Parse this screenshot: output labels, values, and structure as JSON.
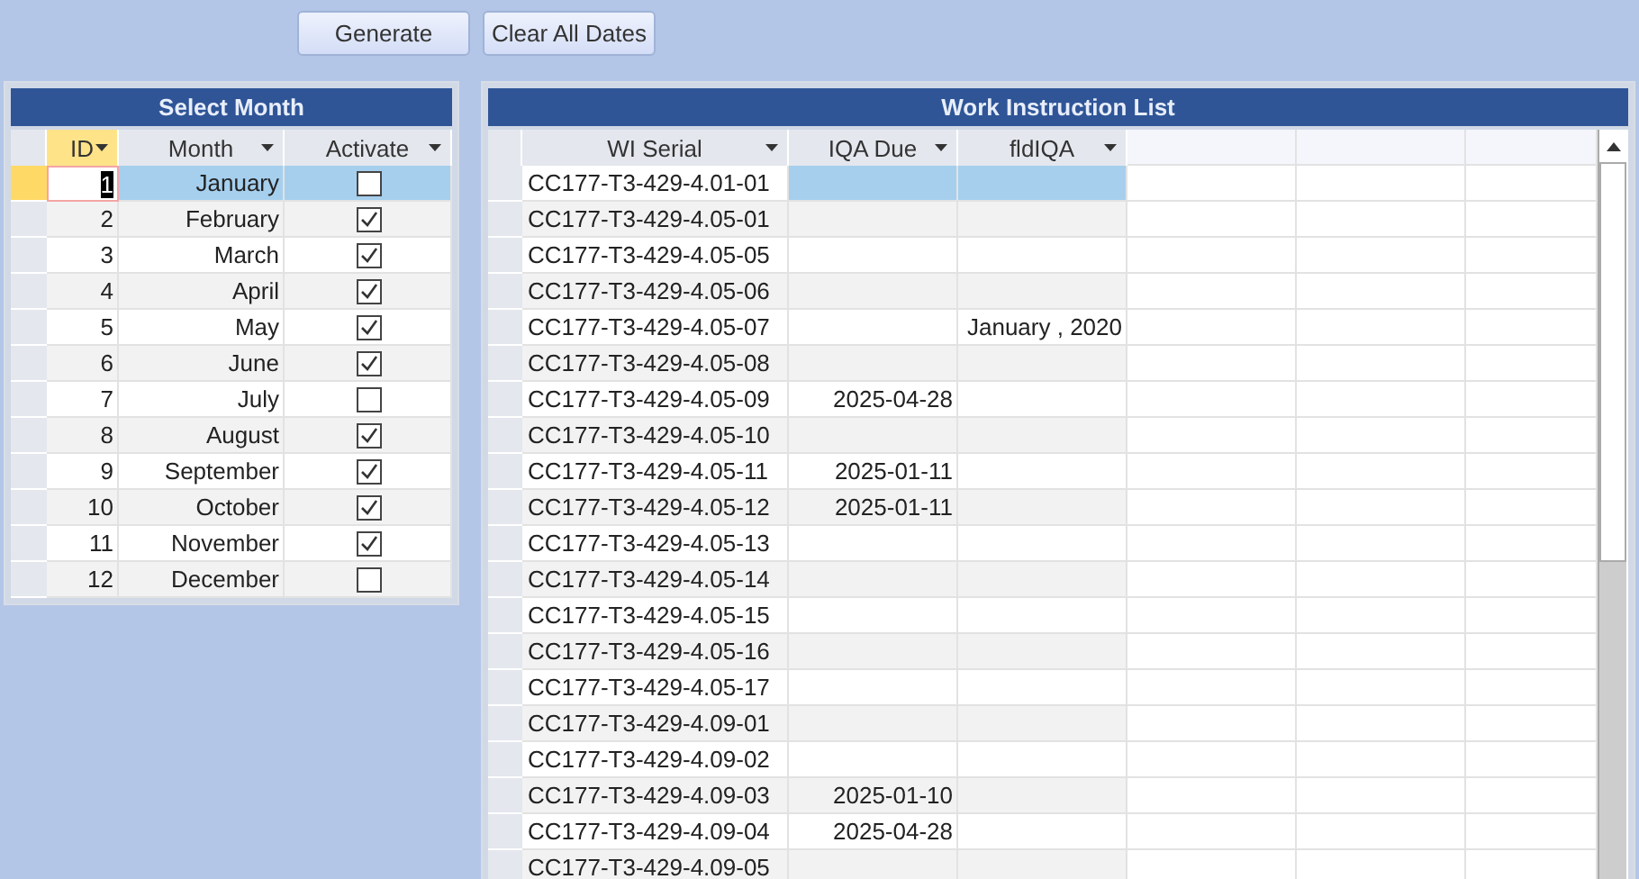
{
  "buttons": [
    "Generate",
    "Clear All Dates"
  ],
  "select_month": {
    "title": "Select Month",
    "columns": [
      {
        "label": "ID",
        "selected": true
      },
      {
        "label": "Month",
        "selected": false
      },
      {
        "label": "Activate",
        "selected": false
      }
    ],
    "rows": [
      {
        "id": "1",
        "month": "January",
        "activate": false,
        "selected": true
      },
      {
        "id": "2",
        "month": "February",
        "activate": true,
        "selected": false
      },
      {
        "id": "3",
        "month": "March",
        "activate": true,
        "selected": false
      },
      {
        "id": "4",
        "month": "April",
        "activate": true,
        "selected": false
      },
      {
        "id": "5",
        "month": "May",
        "activate": true,
        "selected": false
      },
      {
        "id": "6",
        "month": "June",
        "activate": true,
        "selected": false
      },
      {
        "id": "7",
        "month": "July",
        "activate": false,
        "selected": false
      },
      {
        "id": "8",
        "month": "August",
        "activate": true,
        "selected": false
      },
      {
        "id": "9",
        "month": "September",
        "activate": true,
        "selected": false
      },
      {
        "id": "10",
        "month": "October",
        "activate": true,
        "selected": false
      },
      {
        "id": "11",
        "month": "November",
        "activate": true,
        "selected": false
      },
      {
        "id": "12",
        "month": "December",
        "activate": false,
        "selected": false
      }
    ]
  },
  "work_instruction_list": {
    "title": "Work Instruction List",
    "columns": [
      {
        "label": "WI Serial",
        "selected": false
      },
      {
        "label": "IQA Due",
        "selected": false
      },
      {
        "label": "fldIQA",
        "selected": false
      }
    ],
    "rows": [
      {
        "wi_serial": "CC177-T3-429-4.01-01",
        "iqa_due": "",
        "fld_iqa": "",
        "selected": true
      },
      {
        "wi_serial": "CC177-T3-429-4.05-01",
        "iqa_due": "",
        "fld_iqa": "",
        "selected": false
      },
      {
        "wi_serial": "CC177-T3-429-4.05-05",
        "iqa_due": "",
        "fld_iqa": "",
        "selected": false
      },
      {
        "wi_serial": "CC177-T3-429-4.05-06",
        "iqa_due": "",
        "fld_iqa": "",
        "selected": false
      },
      {
        "wi_serial": "CC177-T3-429-4.05-07",
        "iqa_due": "",
        "fld_iqa": "January , 2020",
        "selected": false
      },
      {
        "wi_serial": "CC177-T3-429-4.05-08",
        "iqa_due": "",
        "fld_iqa": "",
        "selected": false
      },
      {
        "wi_serial": "CC177-T3-429-4.05-09",
        "iqa_due": "2025-04-28",
        "fld_iqa": "",
        "selected": false
      },
      {
        "wi_serial": "CC177-T3-429-4.05-10",
        "iqa_due": "",
        "fld_iqa": "",
        "selected": false
      },
      {
        "wi_serial": "CC177-T3-429-4.05-11",
        "iqa_due": "2025-01-11",
        "fld_iqa": "",
        "selected": false
      },
      {
        "wi_serial": "CC177-T3-429-4.05-12",
        "iqa_due": "2025-01-11",
        "fld_iqa": "",
        "selected": false
      },
      {
        "wi_serial": "CC177-T3-429-4.05-13",
        "iqa_due": "",
        "fld_iqa": "",
        "selected": false
      },
      {
        "wi_serial": "CC177-T3-429-4.05-14",
        "iqa_due": "",
        "fld_iqa": "",
        "selected": false
      },
      {
        "wi_serial": "CC177-T3-429-4.05-15",
        "iqa_due": "",
        "fld_iqa": "",
        "selected": false
      },
      {
        "wi_serial": "CC177-T3-429-4.05-16",
        "iqa_due": "",
        "fld_iqa": "",
        "selected": false
      },
      {
        "wi_serial": "CC177-T3-429-4.05-17",
        "iqa_due": "",
        "fld_iqa": "",
        "selected": false
      },
      {
        "wi_serial": "CC177-T3-429-4.09-01",
        "iqa_due": "",
        "fld_iqa": "",
        "selected": false
      },
      {
        "wi_serial": "CC177-T3-429-4.09-02",
        "iqa_due": "",
        "fld_iqa": "",
        "selected": false
      },
      {
        "wi_serial": "CC177-T3-429-4.09-03",
        "iqa_due": "2025-01-10",
        "fld_iqa": "",
        "selected": false
      },
      {
        "wi_serial": "CC177-T3-429-4.09-04",
        "iqa_due": "2025-04-28",
        "fld_iqa": "",
        "selected": false
      },
      {
        "wi_serial": "CC177-T3-429-4.09-05",
        "iqa_due": "",
        "fld_iqa": "",
        "selected": false
      }
    ]
  }
}
